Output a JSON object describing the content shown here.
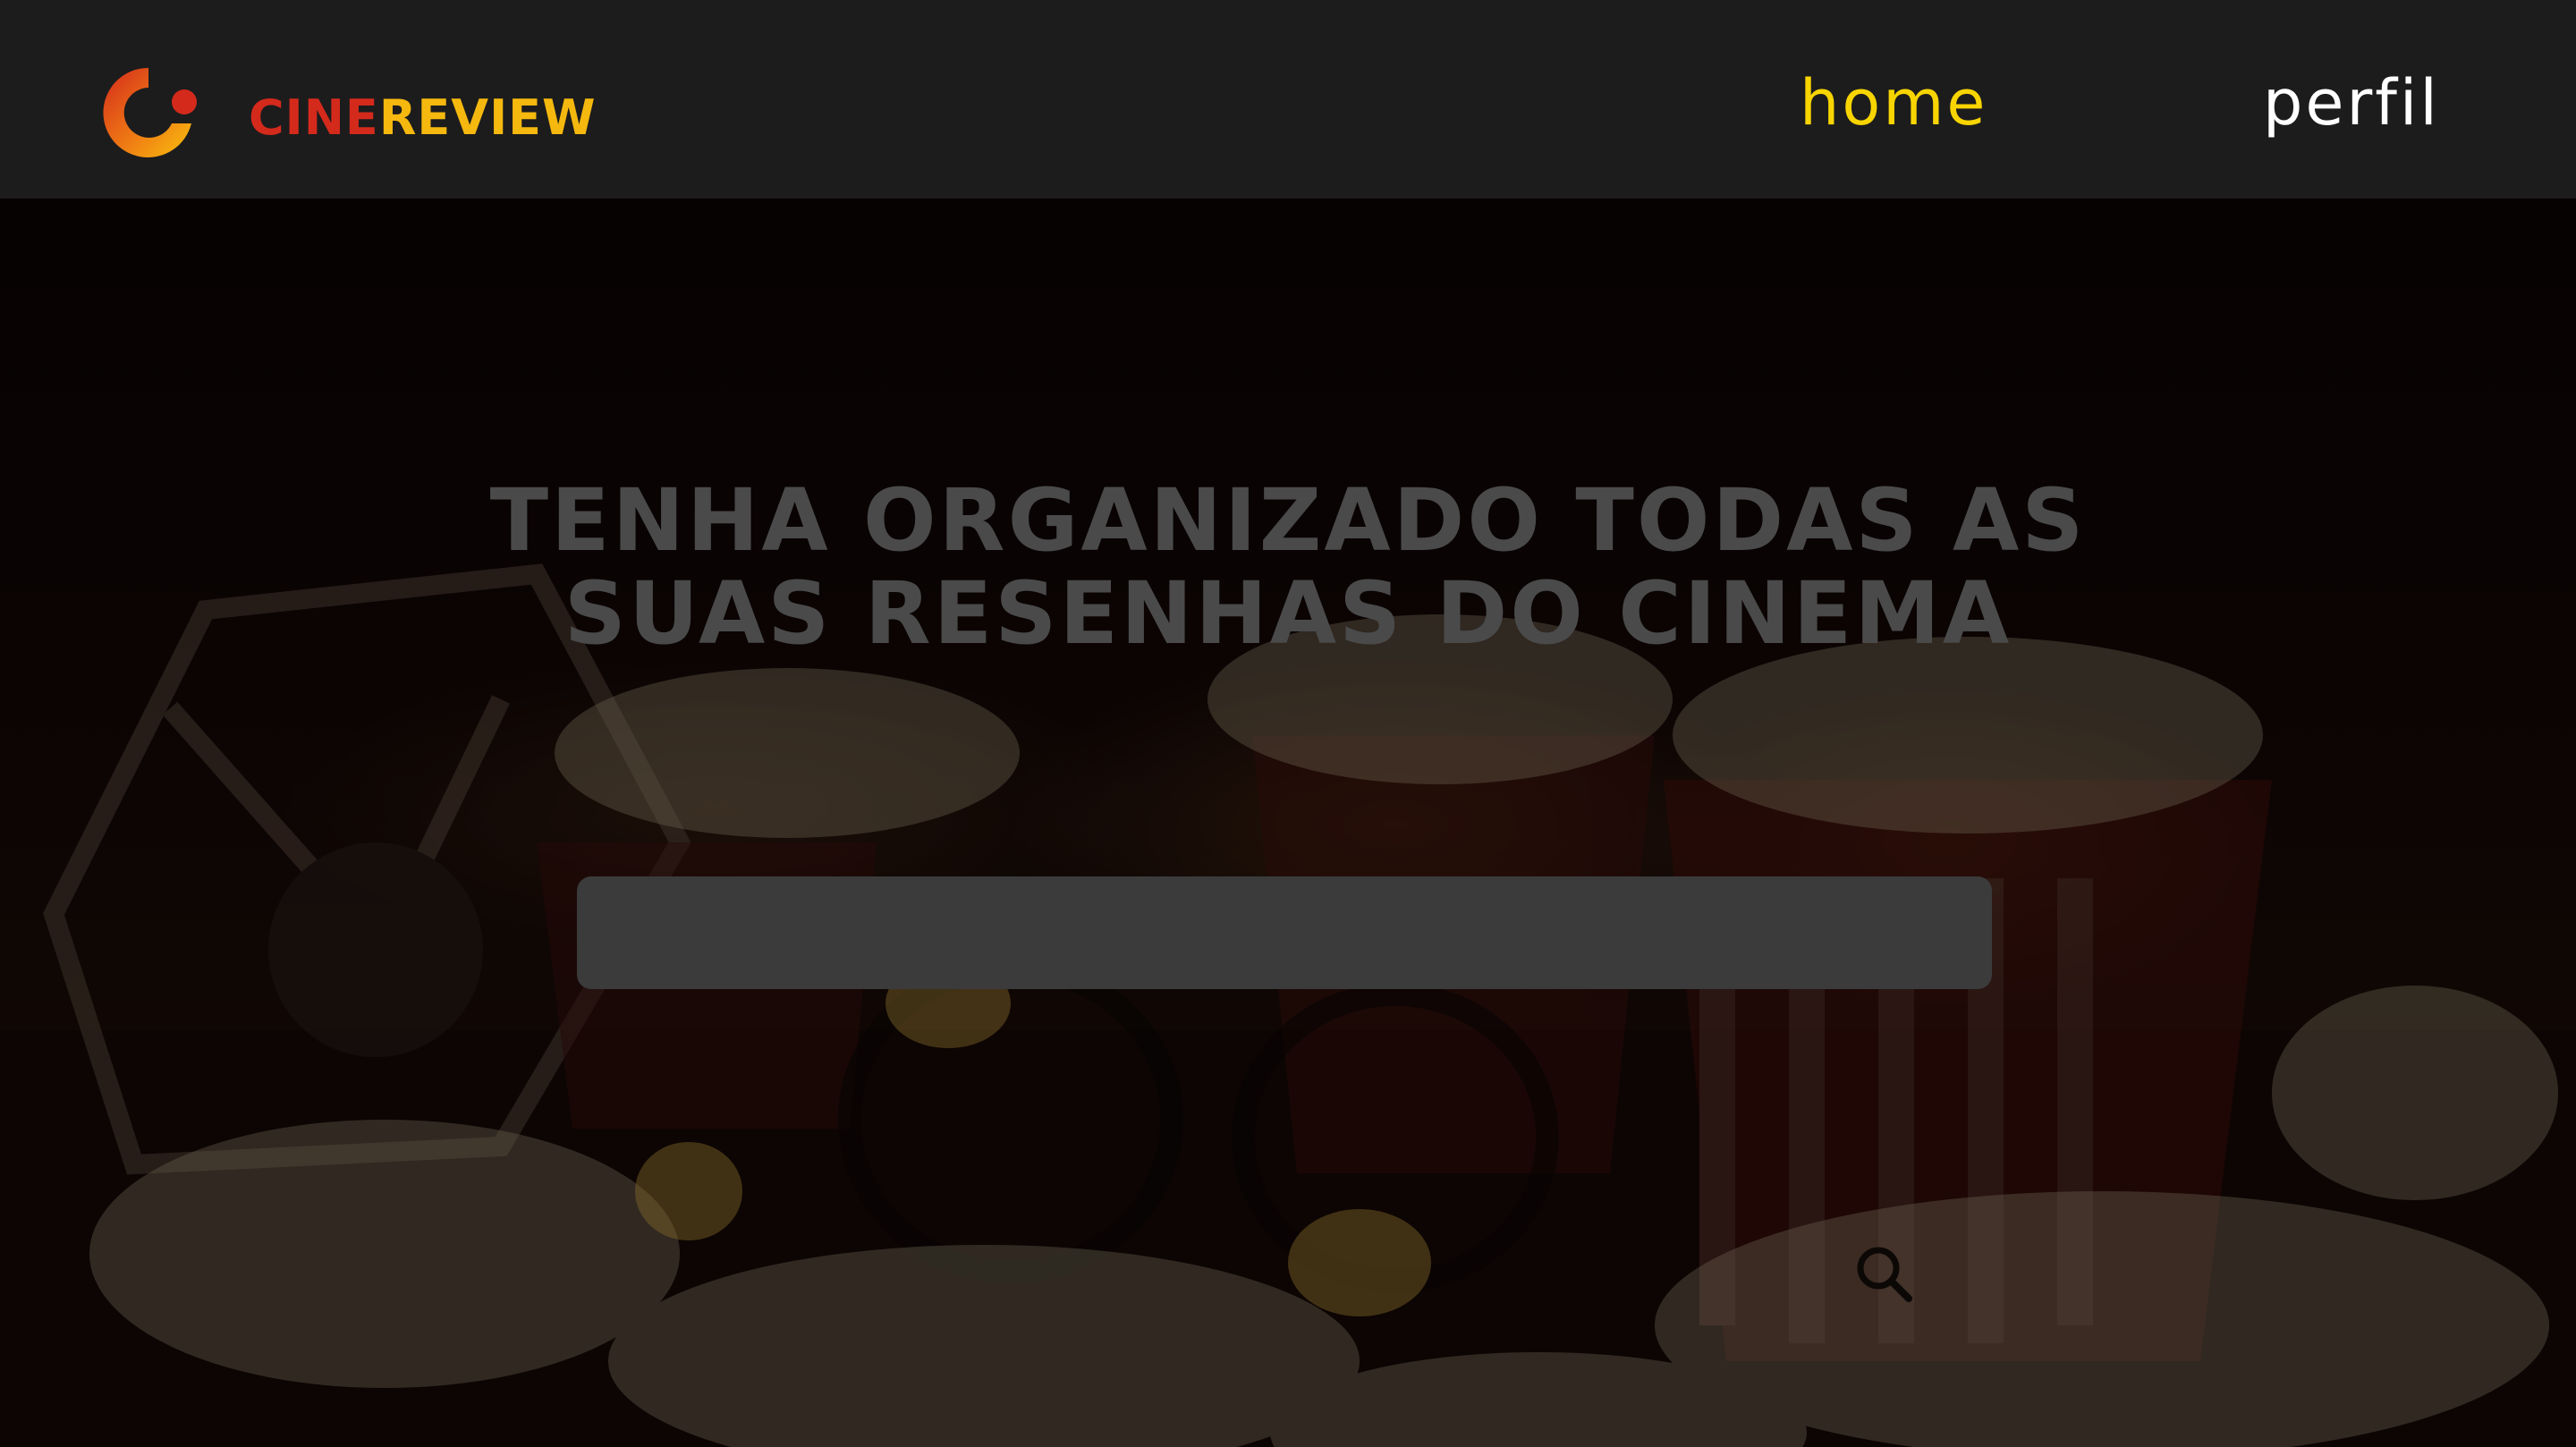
{
  "header": {
    "brand": {
      "part_a": "CINE",
      "part_b": "REVIEW"
    },
    "logo_icon": "cinereview-logo-icon",
    "nav": {
      "home_label": "home",
      "perfil_label": "perfil"
    }
  },
  "hero": {
    "title_line_1": "TENHA ORGANIZADO TODAS AS",
    "title_line_2": "SUAS RESENHAS DO CINEMA",
    "search": {
      "value": "",
      "icon": "search-icon"
    }
  },
  "colors": {
    "header_bg": "#1c1c1d",
    "brand_red": "#d42a1c",
    "brand_yellow": "#f5b80e",
    "nav_active": "#f8d500",
    "nav_inactive": "#ffffff",
    "title_gray": "#4a4a4b",
    "search_bg": "#3b3b3c"
  }
}
